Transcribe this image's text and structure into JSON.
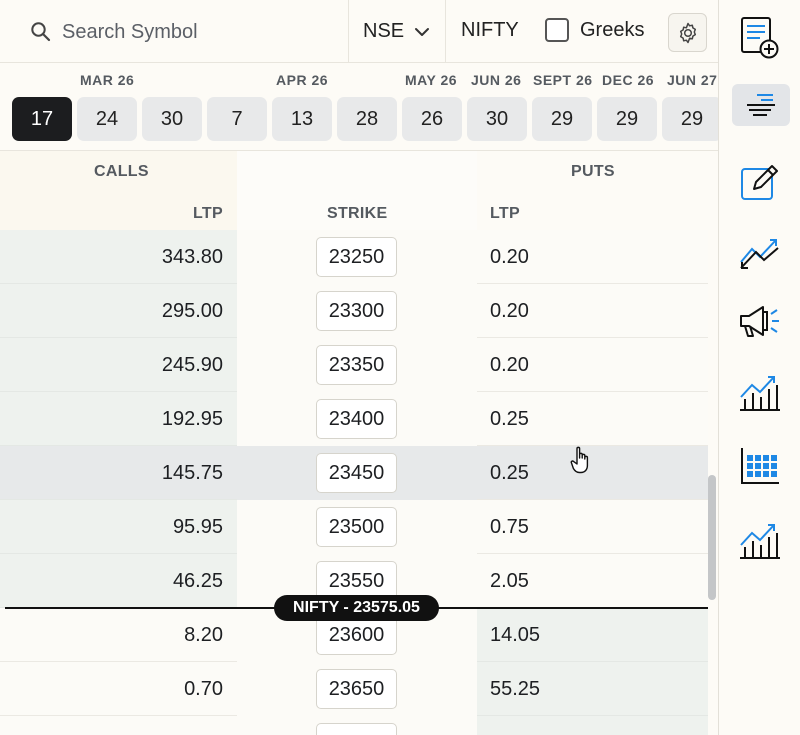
{
  "search": {
    "placeholder": "Search Symbol"
  },
  "exchange": {
    "selected": "NSE"
  },
  "symbol": "NIFTY",
  "greeks": {
    "label": "Greeks",
    "checked": false
  },
  "expiry": {
    "months": [
      "MAR 26",
      "APR 26",
      "MAY 26",
      "JUN 26",
      "SEPT 26",
      "DEC 26",
      "JUN 27"
    ],
    "dates": [
      "17",
      "24",
      "30",
      "7",
      "13",
      "28",
      "26",
      "30",
      "29",
      "29",
      "29"
    ],
    "selected_index": 0
  },
  "columns": {
    "calls": "CALLS",
    "puts": "PUTS",
    "call_ltp": "LTP",
    "strike": "STRIKE",
    "put_ltp": "LTP"
  },
  "chain": [
    {
      "call_ltp": "343.80",
      "strike": "23250",
      "put_ltp": "0.20"
    },
    {
      "call_ltp": "295.00",
      "strike": "23300",
      "put_ltp": "0.20"
    },
    {
      "call_ltp": "245.90",
      "strike": "23350",
      "put_ltp": "0.20"
    },
    {
      "call_ltp": "192.95",
      "strike": "23400",
      "put_ltp": "0.25"
    },
    {
      "call_ltp": "145.75",
      "strike": "23450",
      "put_ltp": "0.25"
    },
    {
      "call_ltp": "95.95",
      "strike": "23500",
      "put_ltp": "0.75"
    },
    {
      "call_ltp": "46.25",
      "strike": "23550",
      "put_ltp": "2.05"
    },
    {
      "call_ltp": "8.20",
      "strike": "23600",
      "put_ltp": "14.05"
    },
    {
      "call_ltp": "0.70",
      "strike": "23650",
      "put_ltp": "55.25"
    },
    {
      "call_ltp": "",
      "strike": "",
      "put_ltp": ""
    }
  ],
  "spot": {
    "label": "NIFTY - 23575.05"
  },
  "rail": {
    "icons": [
      "add-watchlist-icon",
      "option-chain-icon",
      "edit-order-icon",
      "strategy-chart-icon",
      "announcements-icon",
      "bar-chart-icon",
      "heatmap-icon",
      "analytics-chart-icon"
    ]
  },
  "colors": {
    "accent": "#1e88e5",
    "selected_date": "#1c1d1f",
    "itm_fill": "#eef2ee"
  }
}
